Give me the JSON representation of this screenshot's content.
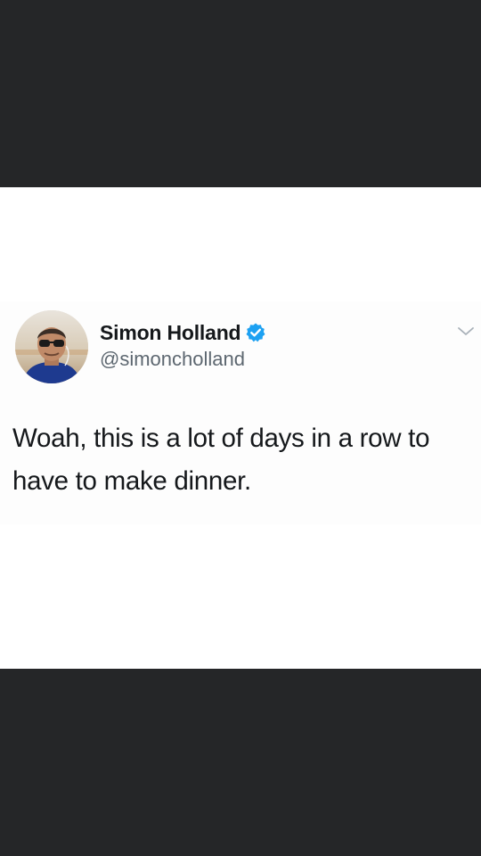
{
  "tweet": {
    "author": {
      "display_name": "Simon Holland",
      "handle": "@simoncholland",
      "verified": true,
      "verified_icon": "verified-badge-icon",
      "avatar": "profile-photo"
    },
    "menu_icon": "chevron-down-icon",
    "text": "Woah, this is a lot of days in a row to have to make dinner."
  },
  "colors": {
    "background_dark": "#252628",
    "card_background": "#ffffff",
    "text_primary": "#15181b",
    "text_secondary": "#5d6770",
    "verified_blue": "#1da1f2",
    "caret_gray": "#a8b0b8"
  }
}
